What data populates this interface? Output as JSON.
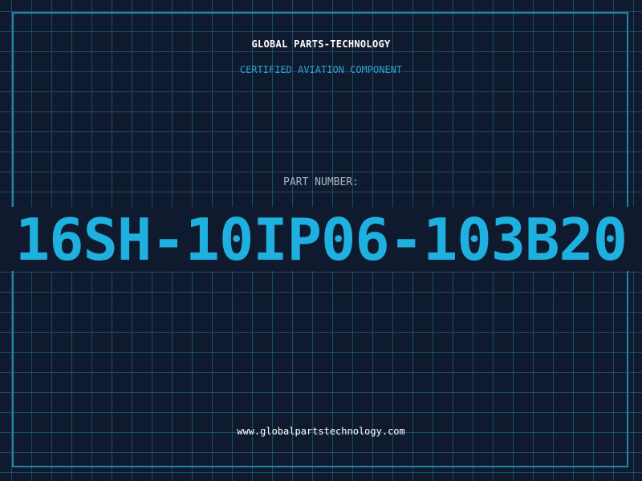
{
  "header": {
    "brand": "GLOBAL PARTS-TECHNOLOGY",
    "subtitle": "CERTIFIED AVIATION COMPONENT"
  },
  "part": {
    "label": "PART NUMBER:",
    "number": "16SH-10IP06-103B20"
  },
  "footer": {
    "website": "www.globalpartstechnology.com"
  },
  "colors": {
    "background": "#101a2f",
    "grid": "#20788c",
    "frame": "#1b86a8",
    "accent": "#1eb0de",
    "text": "#ffffff",
    "muted": "#a9b4c6"
  }
}
